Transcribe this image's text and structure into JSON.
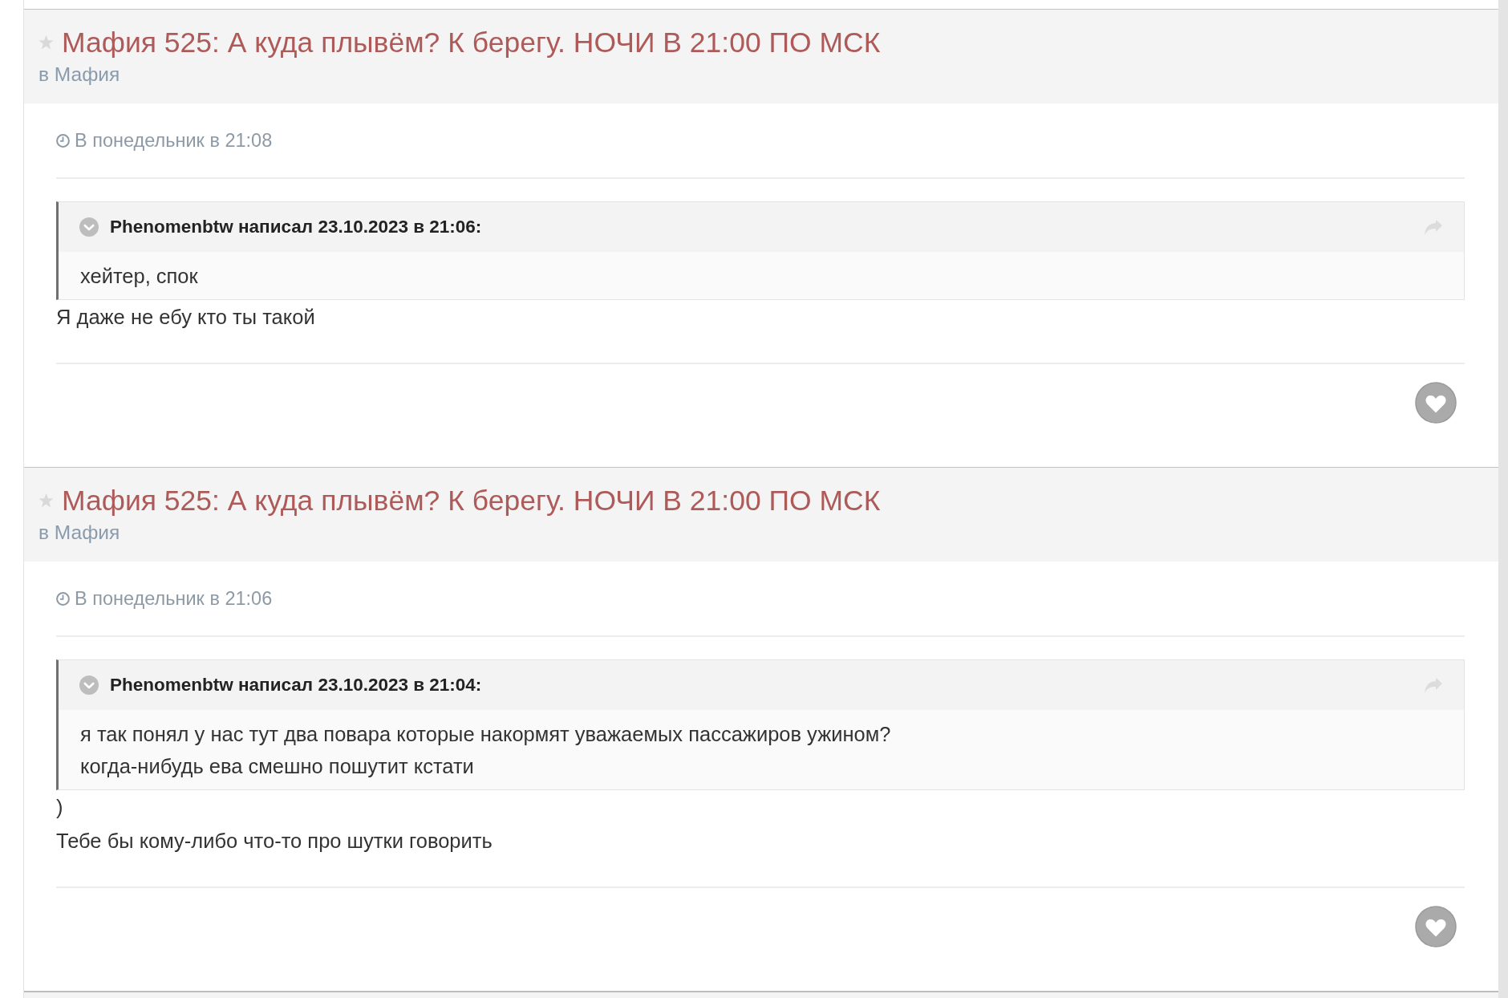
{
  "posts": [
    {
      "thread_title": "Мафия 525: А куда плывём? К берегу. НОЧИ В 21:00 ПО МСК",
      "starred": false,
      "forum": "в Мафия",
      "timestamp": "В понедельник в 21:08",
      "quote": {
        "author_line": "Phenomenbtw написал 23.10.2023 в 21:06:",
        "lines": [
          "хейтер, спок"
        ]
      },
      "message_lines": [
        "Я даже не ебу кто ты такой"
      ],
      "liked": false
    },
    {
      "thread_title": "Мафия 525: А куда плывём? К берегу. НОЧИ В 21:00 ПО МСК",
      "starred": false,
      "forum": "в Мафия",
      "timestamp": "В понедельник в 21:06",
      "quote": {
        "author_line": "Phenomenbtw написал 23.10.2023 в 21:04:",
        "lines": [
          "я так понял у нас тут два повара которые накормят уважаемых пассажиров ужином?",
          "когда-нибудь ева смешно пошутит кстати"
        ]
      },
      "message_lines": [
        ")",
        "Тебе бы кому-либо что-то про шутки говорить"
      ],
      "liked": false
    }
  ]
}
